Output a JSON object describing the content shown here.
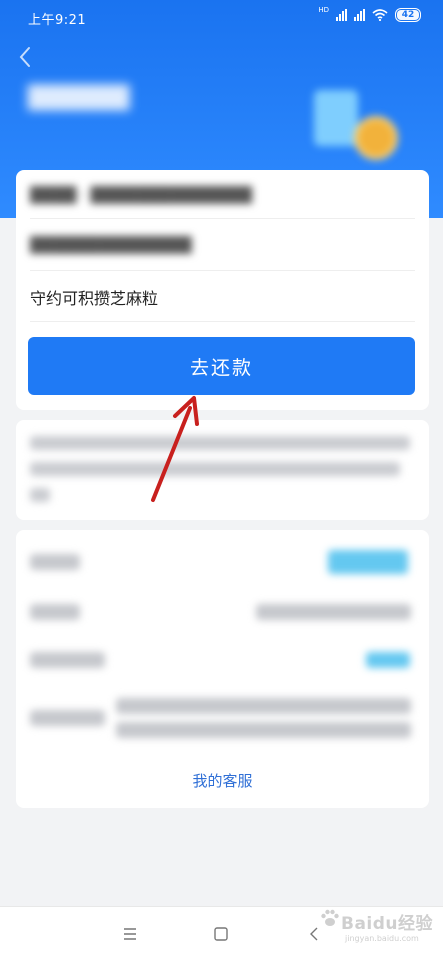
{
  "status_bar": {
    "time": "上午9:21",
    "network": "HD",
    "battery": "42"
  },
  "card": {
    "promise_text": "守约可积攒芝麻粒",
    "repay_button_label": "去还款"
  },
  "details": {
    "service_link": "我的客服"
  },
  "watermark": {
    "main": "Baidu经验",
    "url": "jingyan.baidu.com"
  },
  "colors": {
    "header_blue": "#1a73f0",
    "button_blue": "#1f7af5",
    "link_blue": "#2f6fd6",
    "annotation_red": "#c8201e"
  }
}
